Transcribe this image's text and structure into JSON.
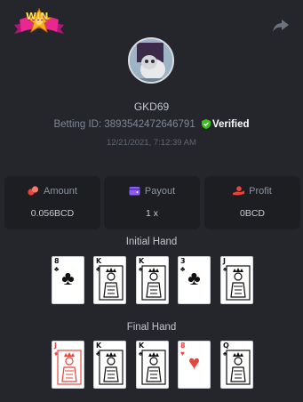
{
  "header": {
    "badge_text": "WIN",
    "share_icon": "share-icon"
  },
  "player": {
    "username": "GKD69",
    "betting_id_label": "Betting ID:",
    "betting_id": "3893542472646791",
    "verified_label": "Verified",
    "timestamp": "12/21/2021, 7:12:39 AM"
  },
  "stats": {
    "amount": {
      "label": "Amount",
      "value": "0.056BCD",
      "icon": "coins-icon"
    },
    "payout": {
      "label": "Payout",
      "value": "1 x",
      "icon": "wallet-icon"
    },
    "profit": {
      "label": "Profit",
      "value": "0BCD",
      "icon": "hand-coin-icon"
    }
  },
  "colors": {
    "background": "#24262b",
    "panel": "#1c1e22",
    "accent_red": "#e8453c",
    "verified_green": "#3bc117",
    "payout_purple": "#8e5cf7"
  },
  "initial_hand": {
    "title": "Initial Hand",
    "cards": [
      {
        "rank": "8",
        "suit": "♣",
        "color": "black",
        "face": false
      },
      {
        "rank": "K",
        "suit": "♣",
        "color": "black",
        "face": true
      },
      {
        "rank": "K",
        "suit": "♠",
        "color": "black",
        "face": true
      },
      {
        "rank": "3",
        "suit": "♣",
        "color": "black",
        "face": false
      },
      {
        "rank": "J",
        "suit": "♠",
        "color": "black",
        "face": true
      }
    ]
  },
  "final_hand": {
    "title": "Final Hand",
    "cards": [
      {
        "rank": "J",
        "suit": "♦",
        "color": "red",
        "face": true
      },
      {
        "rank": "K",
        "suit": "♣",
        "color": "black",
        "face": true
      },
      {
        "rank": "K",
        "suit": "♠",
        "color": "black",
        "face": true
      },
      {
        "rank": "8",
        "suit": "♥",
        "color": "red",
        "face": false
      },
      {
        "rank": "Q",
        "suit": "♠",
        "color": "black",
        "face": true
      }
    ]
  }
}
